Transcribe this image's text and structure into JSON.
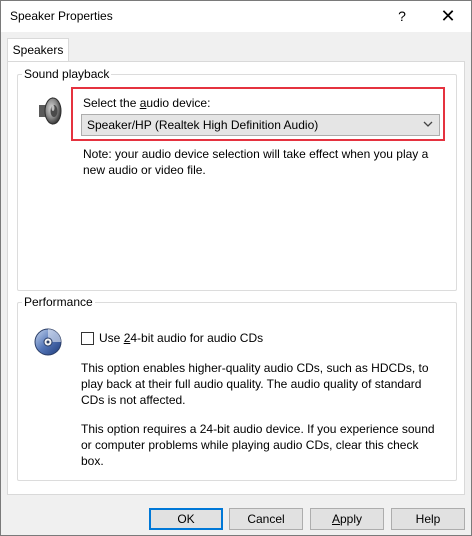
{
  "window": {
    "title": "Speaker Properties",
    "help_glyph": "?",
    "close_glyph": "✕"
  },
  "tabs": [
    {
      "label": "Speakers",
      "selected": true
    }
  ],
  "sound_playback": {
    "group_label": "Sound playback",
    "select_label": "Select the audio device:",
    "select_label_parts": {
      "before": "Select the ",
      "underlined": "a",
      "after": "udio device:"
    },
    "selected_device": "Speaker/HP (Realtek High Definition Audio)",
    "note": "Note: your audio device selection will take effect when you play a new audio or video file."
  },
  "performance": {
    "group_label": "Performance",
    "checkbox_checked": false,
    "checkbox_label": "Use 24-bit audio for audio CDs",
    "checkbox_label_parts": {
      "before": "Use ",
      "underlined": "2",
      "after": "4-bit audio for audio CDs"
    },
    "paragraph1": "This option enables higher-quality audio CDs, such as HDCDs, to play back at their full audio quality. The audio quality of standard CDs is not affected.",
    "paragraph2": "This option requires a 24-bit audio device. If you experience sound or computer problems while playing audio CDs, clear this check box."
  },
  "buttons": {
    "ok": "OK",
    "cancel": "Cancel",
    "apply": {
      "before": "",
      "underlined": "A",
      "after": "pply"
    },
    "help": "Help"
  },
  "colors": {
    "highlight": "#e5323f",
    "default_button_border": "#0078d7"
  }
}
